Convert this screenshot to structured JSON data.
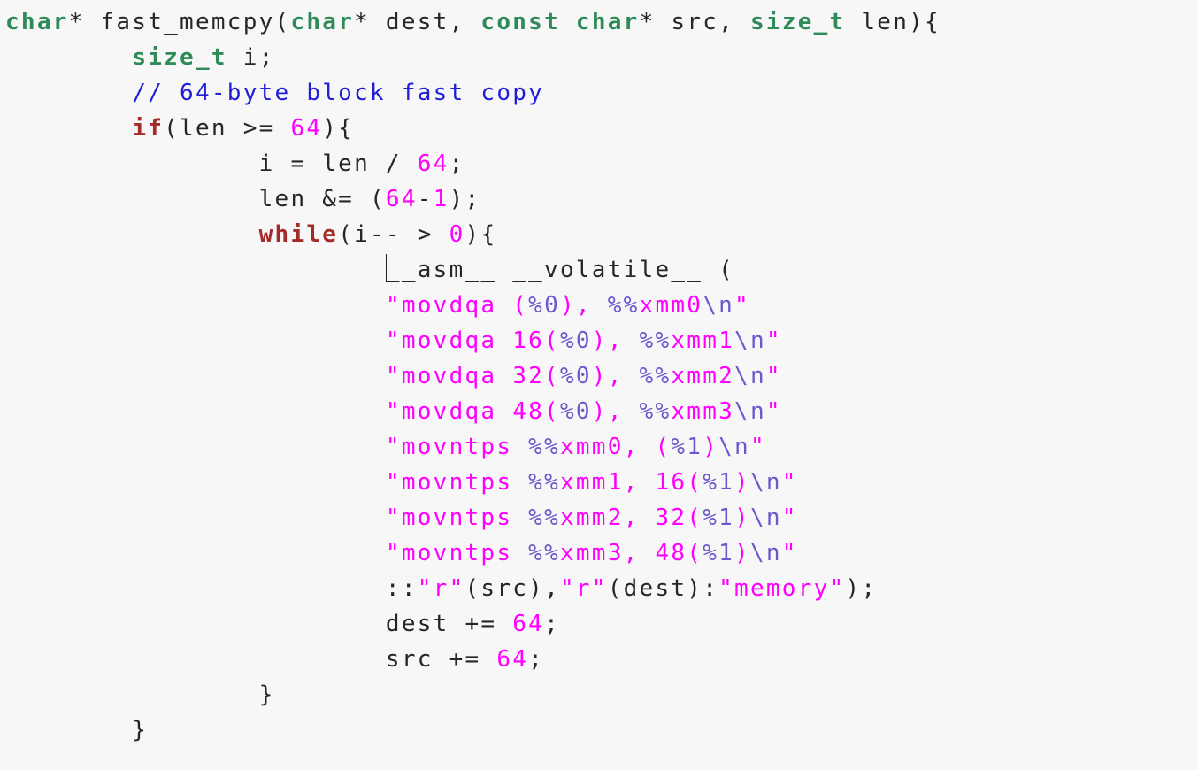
{
  "editor": {
    "language": "C",
    "cursor": {
      "line": 8,
      "column": 24
    },
    "colors": {
      "background": "#f7f7f7",
      "text": "#262626",
      "type": "#2e8b57",
      "keyword": "#a52a2a",
      "comment": "#1f1fd8",
      "number": "#ff00ff",
      "string": "#ff00ff",
      "special": "#6a5acd"
    },
    "lines": [
      "char* fast_memcpy(char* dest, const char* src, size_t len){",
      "\tsize_t i;",
      "\t// 64-byte block fast copy",
      "\tif(len >= 64){",
      "\t\ti = len / 64;",
      "\t\tlen &= (64-1);",
      "\t\twhile(i-- > 0){",
      "\t\t\t__asm__ __volatile__ (",
      "\t\t\t\"movdqa (%0), %%xmm0\\n\"",
      "\t\t\t\"movdqa 16(%0), %%xmm1\\n\"",
      "\t\t\t\"movdqa 32(%0), %%xmm2\\n\"",
      "\t\t\t\"movdqa 48(%0), %%xmm3\\n\"",
      "\t\t\t\"movntps %%xmm0, (%1)\\n\"",
      "\t\t\t\"movntps %%xmm1, 16(%1)\\n\"",
      "\t\t\t\"movntps %%xmm2, 32(%1)\\n\"",
      "\t\t\t\"movntps %%xmm3, 48(%1)\\n\"",
      "\t\t\t::\"r\"(src),\"r\"(dest):\"memory\");",
      "\t\t\tdest += 64;",
      "\t\t\tsrc += 64;",
      "\t\t}",
      "\t}"
    ]
  }
}
